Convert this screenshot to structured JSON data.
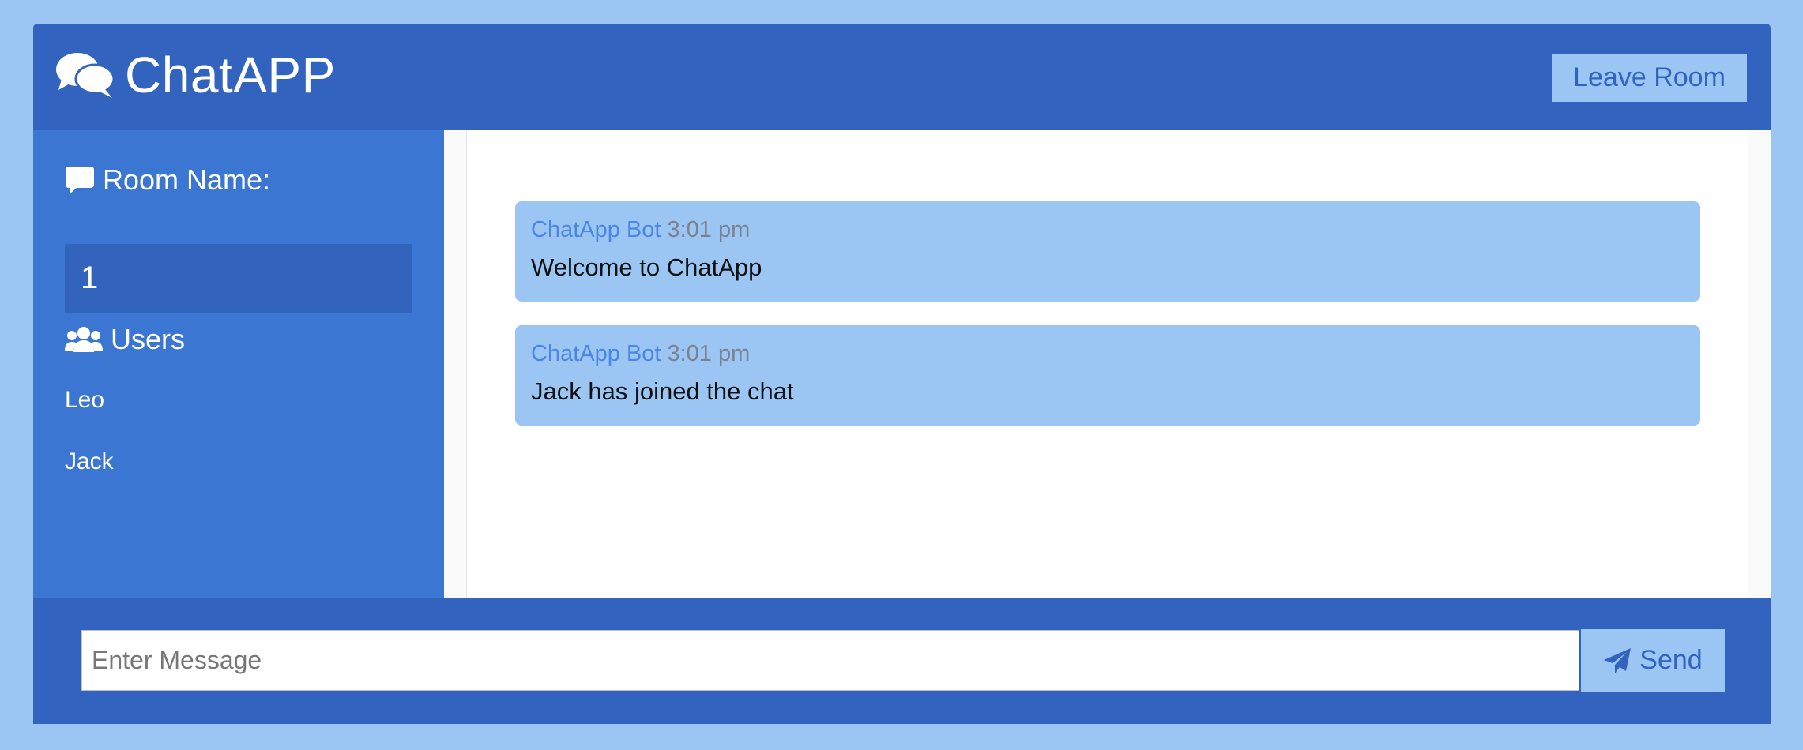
{
  "header": {
    "title": "ChatAPP",
    "leave_label": "Leave Room",
    "logo_icon": "comments-icon"
  },
  "sidebar": {
    "room_heading": "Room Name:",
    "room_name": "1",
    "users_heading": "Users",
    "users": [
      "Leo",
      "Jack"
    ]
  },
  "messages": [
    {
      "author": "ChatApp Bot",
      "time": "3:01 pm",
      "text": "Welcome to ChatApp"
    },
    {
      "author": "ChatApp Bot",
      "time": "3:01 pm",
      "text": "Jack has joined the chat"
    }
  ],
  "composer": {
    "placeholder": "Enter Message",
    "value": "",
    "send_label": "Send"
  },
  "colors": {
    "page_background": "#9bc6f4",
    "primary": "#3263be",
    "sidebar": "#3b76d2",
    "message_bubble": "#9bc6f4",
    "author": "#4a86e2"
  }
}
